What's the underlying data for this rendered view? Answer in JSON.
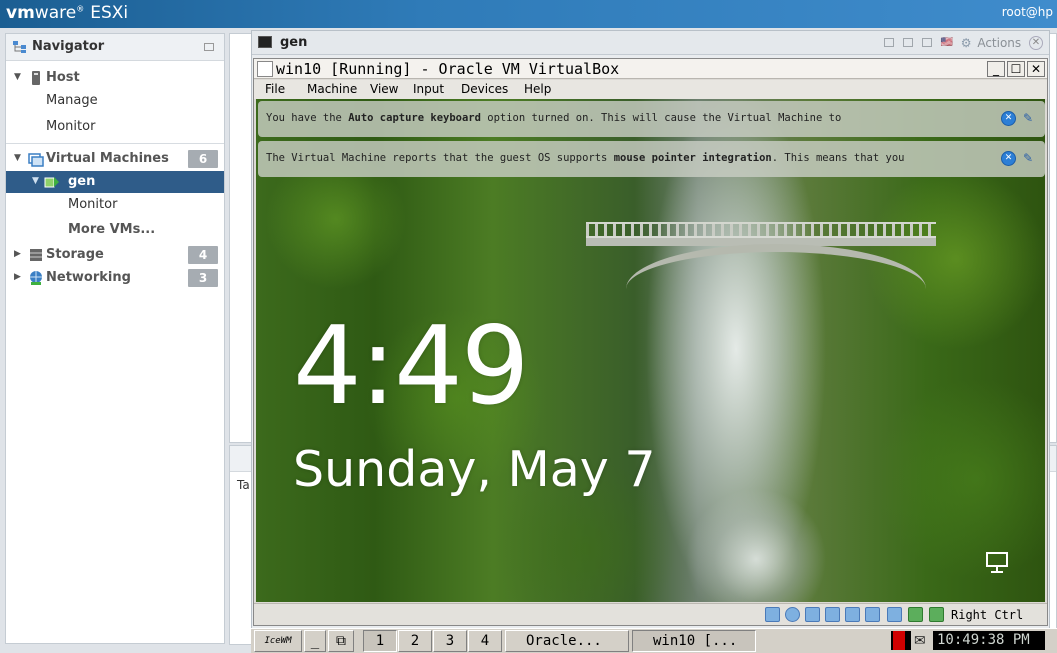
{
  "esxi": {
    "brand_vm": "vm",
    "brand_ware": "ware",
    "brand_product": "ESXi",
    "user": "root@hp"
  },
  "navigator": {
    "title": "Navigator",
    "host": {
      "label": "Host",
      "children": [
        "Manage",
        "Monitor"
      ]
    },
    "virtual_machines": {
      "label": "Virtual Machines",
      "count": "6"
    },
    "selected_vm": {
      "label": "gen",
      "children": [
        "Monitor",
        "More VMs..."
      ]
    },
    "storage": {
      "label": "Storage",
      "count": "4"
    },
    "networking": {
      "label": "Networking",
      "count": "3"
    }
  },
  "background": {
    "tasks_col": "Ta"
  },
  "console": {
    "title": "gen",
    "actions_label": "Actions"
  },
  "vbox": {
    "title": "win10 [Running] - Oracle VM VirtualBox",
    "menu": [
      "File",
      "Machine",
      "View",
      "Input",
      "Devices",
      "Help"
    ],
    "notify1_pre": "You have the ",
    "notify1_bold": "Auto capture keyboard",
    "notify1_post": " option turned on. This will cause the Virtual Machine to",
    "notify2_pre": "The Virtual Machine reports that the guest OS supports ",
    "notify2_bold": "mouse pointer integration",
    "notify2_post": ". This means that you",
    "host_key": "Right Ctrl"
  },
  "lockscreen": {
    "time": "4:49",
    "date": "Sunday, May 7"
  },
  "taskbar": {
    "workspaces": [
      "1",
      "2",
      "3",
      "4"
    ],
    "active_workspace": "1",
    "tasks": [
      "Oracle...",
      "win10 [..."
    ],
    "clock": "10:49:38 PM"
  }
}
